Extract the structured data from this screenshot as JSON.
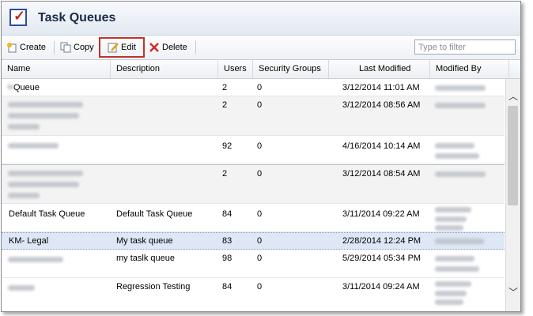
{
  "window": {
    "title": "Task Queues"
  },
  "toolbar": {
    "create_label": "Create",
    "copy_label": "Copy",
    "edit_label": "Edit",
    "delete_label": "Delete",
    "filter_placeholder": "Type to filter"
  },
  "columns": [
    "Name",
    "Description",
    "Users",
    "Security Groups",
    "Last Modified",
    "Modified By"
  ],
  "rows": [
    {
      "name": "Queue",
      "description": "",
      "users": "2",
      "security_groups": "0",
      "last_modified": "3/12/2014 11:01 AM"
    },
    {
      "name": "",
      "description": "",
      "users": "2",
      "security_groups": "0",
      "last_modified": "3/12/2014 08:56 AM"
    },
    {
      "name": "",
      "description": "",
      "users": "92",
      "security_groups": "0",
      "last_modified": "4/16/2014 10:14 AM"
    },
    {
      "name": "",
      "description": "",
      "users": "2",
      "security_groups": "0",
      "last_modified": "3/12/2014 08:54 AM"
    },
    {
      "name": "Default Task Queue",
      "description": "Default Task Queue",
      "users": "84",
      "security_groups": "0",
      "last_modified": "3/11/2014 09:22 AM"
    },
    {
      "name": "KM- Legal",
      "description": "My task queue",
      "users": "83",
      "security_groups": "0",
      "last_modified": "2/28/2014 12:24 PM"
    },
    {
      "name": "",
      "description": "my taslk queue",
      "users": "98",
      "security_groups": "0",
      "last_modified": "5/29/2014 05:34 PM"
    },
    {
      "name": "",
      "description": "Regression Testing",
      "users": "84",
      "security_groups": "0",
      "last_modified": "3/11/2014 09:24 AM"
    }
  ],
  "colors": {
    "highlight_border": "#c0322b",
    "selected_row": "#dde7f5"
  }
}
